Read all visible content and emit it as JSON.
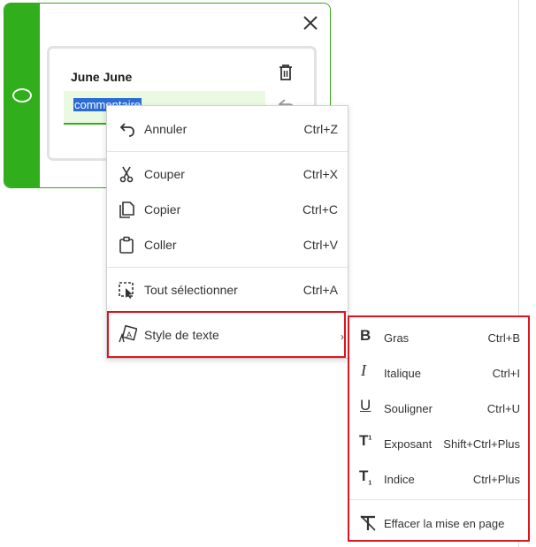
{
  "note": {
    "title": "June June",
    "comment_value": "commentaire"
  },
  "context_menu": {
    "items": [
      {
        "label": "Annuler",
        "shortcut": "Ctrl+Z",
        "icon": "undo-icon"
      },
      {
        "label": "Couper",
        "shortcut": "Ctrl+X",
        "icon": "scissors-icon"
      },
      {
        "label": "Copier",
        "shortcut": "Ctrl+C",
        "icon": "copy-icon"
      },
      {
        "label": "Coller",
        "shortcut": "Ctrl+V",
        "icon": "clipboard-icon"
      },
      {
        "label": "Tout sélectionner",
        "shortcut": "Ctrl+A",
        "icon": "select-all-icon"
      },
      {
        "label": "Style de texte",
        "shortcut": "",
        "icon": "text-style-icon"
      }
    ]
  },
  "text_style_submenu": {
    "items": [
      {
        "label": "Gras",
        "shortcut": "Ctrl+B",
        "icon": "bold-icon"
      },
      {
        "label": "Italique",
        "shortcut": "Ctrl+I",
        "icon": "italic-icon"
      },
      {
        "label": "Souligner",
        "shortcut": "Ctrl+U",
        "icon": "underline-icon"
      },
      {
        "label": "Exposant",
        "shortcut": "Shift+Ctrl+Plus",
        "icon": "superscript-icon"
      },
      {
        "label": "Indice",
        "shortcut": "Ctrl+Plus",
        "icon": "subscript-icon"
      },
      {
        "label": "Effacer la mise en page",
        "shortcut": "",
        "icon": "clear-formatting-icon"
      }
    ]
  },
  "colors": {
    "note_green": "#31ae1b",
    "comment_bg": "#e9f9e2",
    "selection_blue": "#2a6bd4",
    "highlight_red": "#e0151c"
  }
}
